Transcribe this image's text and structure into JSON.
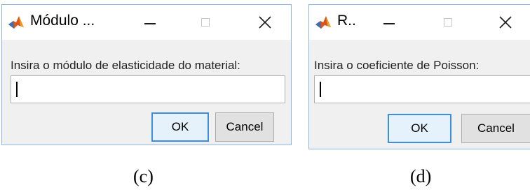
{
  "dialogs": [
    {
      "title": "Módulo ...",
      "prompt": "Insira o módulo de elasticidade do material:",
      "input_value": "",
      "ok_label": "OK",
      "cancel_label": "Cancel",
      "caption": "(c)"
    },
    {
      "title": "R..",
      "prompt": "Insira o coeficiente de Poisson:",
      "input_value": "",
      "ok_label": "OK",
      "cancel_label": "Cancel",
      "caption": "(d)"
    }
  ],
  "icons": {
    "app": "matlab-icon",
    "minimize": "minimize-icon",
    "maximize": "maximize-icon",
    "close": "close-icon"
  },
  "colors": {
    "window_border": "#8fb6e0",
    "ok_border": "#3c8ee0",
    "ok_fill": "#e5f1fb",
    "dialog_bg": "#f0f0f0"
  }
}
